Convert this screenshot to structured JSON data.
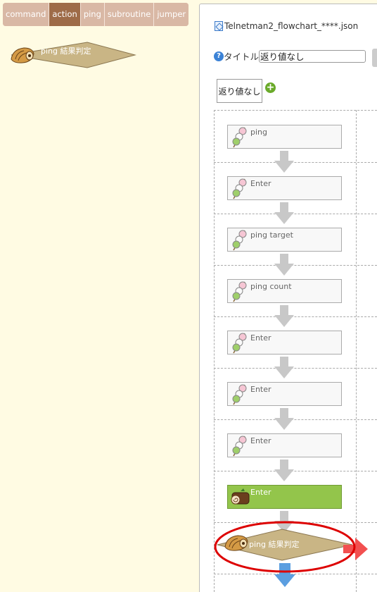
{
  "tabs": [
    {
      "label": "command",
      "active": false
    },
    {
      "label": "action",
      "active": true
    },
    {
      "label": "ping",
      "active": false
    },
    {
      "label": "subroutine",
      "active": false
    },
    {
      "label": "jumper",
      "active": false
    }
  ],
  "palette": {
    "item_label": "ping 結果判定"
  },
  "panel": {
    "filename": "Telnetman2_flowchart_****.json",
    "title_label": "タイトル",
    "title_value": "返り値なし",
    "return_value": "返り値なし"
  },
  "flow": {
    "nodes": [
      {
        "label": "ping"
      },
      {
        "label": "Enter"
      },
      {
        "label": "ping target"
      },
      {
        "label": "ping count"
      },
      {
        "label": "Enter"
      },
      {
        "label": "Enter"
      },
      {
        "label": "Enter"
      },
      {
        "label": "Enter"
      }
    ],
    "decision_label": "ping 結果判定"
  },
  "colors": {
    "tab_active": "#9e6b48",
    "tab_inactive": "#d9b8a5",
    "background": "#fffbe3",
    "selected_node": "#93c54b",
    "decision_fill": "#c9b585",
    "highlight": "#dd0000"
  }
}
